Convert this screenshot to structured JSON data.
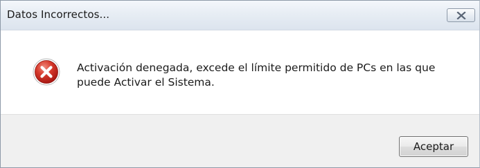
{
  "window": {
    "title": "Datos Incorrectos...",
    "close_icon": "close-icon"
  },
  "dialog": {
    "icon": "error-icon",
    "message": "Activación denegada, excede el límite permitido de PCs en las que puede Activar el Sistema."
  },
  "buttons": {
    "ok_label": "Aceptar"
  },
  "colors": {
    "error_red": "#c8211f",
    "titlebar": "#e7edf4",
    "footer": "#f0f0f0"
  }
}
